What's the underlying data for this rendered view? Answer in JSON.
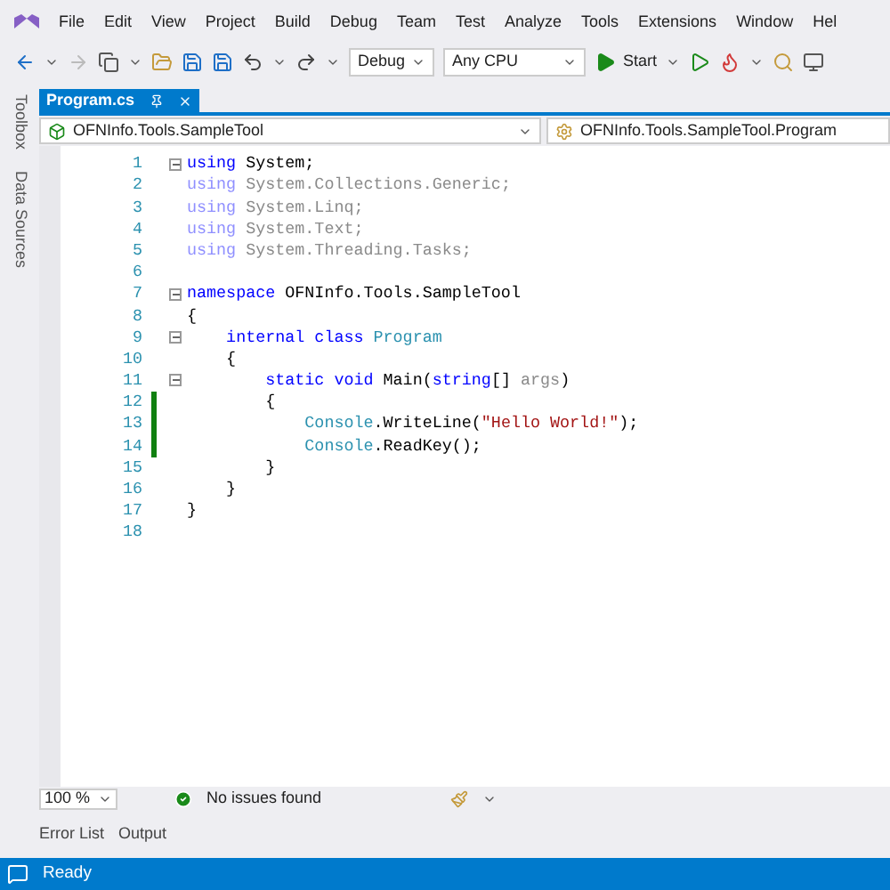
{
  "menu": [
    "File",
    "Edit",
    "View",
    "Project",
    "Build",
    "Debug",
    "Team",
    "Test",
    "Analyze",
    "Tools",
    "Extensions",
    "Window",
    "Hel"
  ],
  "toolbar": {
    "configuration": "Debug",
    "platform": "Any CPU",
    "start": "Start"
  },
  "side_tabs": [
    "Toolbox",
    "Data Sources"
  ],
  "tabs": [
    {
      "label": "Program.cs",
      "selected": true
    }
  ],
  "nav": {
    "project": "OFNInfo.Tools.SampleTool",
    "type": "OFNInfo.Tools.SampleTool.Program"
  },
  "lines": [
    {
      "number": "1",
      "fold": true,
      "changed": false,
      "tokens": [
        {
          "text": "using",
          "kind": "keyword"
        },
        {
          "text": " System;",
          "kind": "plain"
        }
      ]
    },
    {
      "number": "2",
      "fold": false,
      "changed": false,
      "tokens": [
        {
          "text": "using",
          "kind": "faded_keyword"
        },
        {
          "text": " System.Collections.Generic;",
          "kind": "faded"
        }
      ]
    },
    {
      "number": "3",
      "fold": false,
      "changed": false,
      "tokens": [
        {
          "text": "using",
          "kind": "faded_keyword"
        },
        {
          "text": " System.Linq;",
          "kind": "faded"
        }
      ]
    },
    {
      "number": "4",
      "fold": false,
      "changed": false,
      "tokens": [
        {
          "text": "using",
          "kind": "faded_keyword"
        },
        {
          "text": " System.Text;",
          "kind": "faded"
        }
      ]
    },
    {
      "number": "5",
      "fold": false,
      "changed": false,
      "tokens": [
        {
          "text": "using",
          "kind": "faded_keyword"
        },
        {
          "text": " System.Threading.Tasks;",
          "kind": "faded"
        }
      ]
    },
    {
      "number": "6",
      "fold": false,
      "changed": false
    },
    {
      "number": "7",
      "fold": true,
      "changed": false,
      "tokens": [
        {
          "text": "namespace",
          "kind": "keyword"
        },
        {
          "text": " OFNInfo.Tools.SampleTool",
          "kind": "plain"
        }
      ]
    },
    {
      "number": "8",
      "fold": false,
      "changed": false,
      "tokens": [
        {
          "text": "{",
          "kind": "plain"
        }
      ]
    },
    {
      "number": "9",
      "fold": true,
      "changed": false,
      "tokens": [
        {
          "text": "    internal class",
          "kind": "keyword"
        },
        {
          "text": " Program",
          "kind": "type"
        }
      ]
    },
    {
      "number": "10",
      "fold": false,
      "changed": false,
      "tokens": [
        {
          "text": "    {",
          "kind": "plain"
        }
      ]
    },
    {
      "number": "11",
      "fold": true,
      "changed": false,
      "tokens": [
        {
          "text": "        static void",
          "kind": "keyword"
        },
        {
          "text": " Main(",
          "kind": "plain"
        },
        {
          "text": "string",
          "kind": "keyword"
        },
        {
          "text": "[] ",
          "kind": "plain"
        },
        {
          "text": "args",
          "kind": "faded"
        },
        {
          "text": ")",
          "kind": "plain"
        }
      ]
    },
    {
      "number": "12",
      "fold": false,
      "changed": true,
      "tokens": [
        {
          "text": "        {",
          "kind": "plain"
        }
      ]
    },
    {
      "number": "13",
      "fold": false,
      "changed": true,
      "tokens": [
        {
          "text": "            Console",
          "kind": "type"
        },
        {
          "text": ".WriteLine(",
          "kind": "plain"
        },
        {
          "text": "\"Hello World!\"",
          "kind": "string"
        },
        {
          "text": ");",
          "kind": "plain"
        }
      ]
    },
    {
      "number": "14",
      "fold": false,
      "changed": true,
      "tokens": [
        {
          "text": "            Console",
          "kind": "type"
        },
        {
          "text": ".ReadKey();",
          "kind": "plain"
        }
      ]
    },
    {
      "number": "15",
      "fold": false,
      "changed": false,
      "tokens": [
        {
          "text": "        }",
          "kind": "plain"
        }
      ]
    },
    {
      "number": "16",
      "fold": false,
      "changed": false,
      "tokens": [
        {
          "text": "    }",
          "kind": "plain"
        }
      ]
    },
    {
      "number": "17",
      "fold": false,
      "changed": false,
      "tokens": [
        {
          "text": "}",
          "kind": "plain"
        }
      ]
    },
    {
      "number": "18",
      "fold": false,
      "changed": false
    }
  ],
  "editor_status": {
    "zoom": "100 %",
    "issues": "No issues found"
  },
  "bottom_tabs": [
    "Error List",
    "Output"
  ],
  "status_bar": {
    "text": "Ready"
  }
}
